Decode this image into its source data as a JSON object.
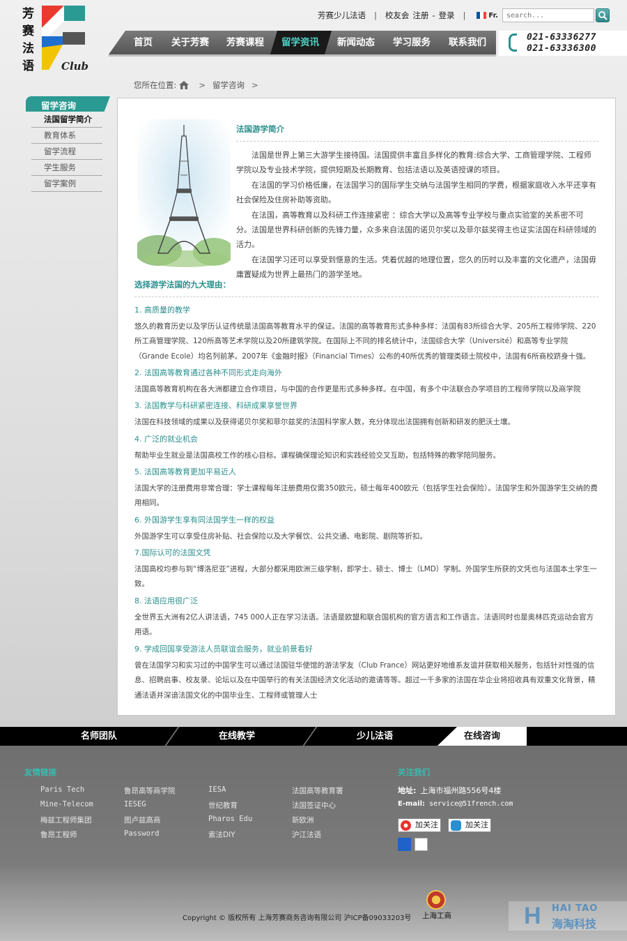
{
  "logo": {
    "chars": [
      "芳",
      "赛",
      "法",
      "语"
    ],
    "club": "Club"
  },
  "toplinks": {
    "kids": "芳赛少儿法语",
    "alumni": "校友会",
    "register": "注册",
    "dash": "-",
    "login": "登录",
    "lang": "Fr.",
    "sep": "|"
  },
  "search": {
    "placeholder": "search..."
  },
  "nav": {
    "items": [
      {
        "label": "首页"
      },
      {
        "label": "关于芳赛"
      },
      {
        "label": "芳赛课程"
      },
      {
        "label": "留学资讯"
      },
      {
        "label": "新闻动态"
      },
      {
        "label": "学习服务"
      },
      {
        "label": "联系我们"
      }
    ],
    "active_index": 3
  },
  "phone": {
    "line1": "021-63336277",
    "line2": "021-63336300"
  },
  "breadcrumb": {
    "prefix": "您所在位置:",
    "sep": ">",
    "current": "留学咨询"
  },
  "sidebar": {
    "title": "留学咨询",
    "items": [
      {
        "label": "法国留学简介"
      },
      {
        "label": "教育体系"
      },
      {
        "label": "留学流程"
      },
      {
        "label": "学生服务"
      },
      {
        "label": "留学案例"
      }
    ]
  },
  "intro": {
    "title": "法国游学简介",
    "paragraphs": [
      "法国是世界上第三大游学生接待国。法国提供丰富且多样化的教育:综合大学、工商管理学院、工程师学院以及专业技术学院，提供短期及长期教育、包括法语以及英语授课的项目。",
      "在法国的学习价格低廉，在法国学习的国际学生交纳与法国学生相同的学费，根据家庭收入水平还享有社会保险及住房补助等资助。",
      "在法国，高等教育以及科研工作连接紧密 ：综合大学以及高等专业学校与重点实验室的关系密不可分。法国是世界科研创新的先锋力量，众多来自法国的诺贝尔奖以及菲尔兹奖得主也证实法国在科研领域的活力。",
      "在法国学习还可以享受到惬意的生活。凭着优越的地理位置，您久的历时以及丰富的文化遗产，法国毋庸置疑成为世界上最热门的游学圣地。"
    ]
  },
  "reasons": {
    "title": "选择游学法国的九大理由：",
    "items": [
      {
        "title": "1. 高质量的教学",
        "text": "悠久的教育历史以及学历认证传统是法国高等教育水平的保证。法国的高等教育形式多种多样：法国有83所综合大学、205所工程师学院、220所工商管理学院、120所高等艺术学院以及20所建筑学院。在国际上不同的排名统计中，法国综合大学（Université）和高等专业学院（Grande Ecole）均名列前茅。2007年《金融时报》（Financial Times）公布的40所优秀的管理类硕士院校中，法国有6所商校跻身十强。"
      },
      {
        "title": "2. 法国高等教育通过各种不同形式走向海外",
        "text": "法国高等教育机构在各大洲都建立合作项目，与中国的合作更是形式多种多样。在中国，有多个中法联合办学项目的工程师学院以及商学院"
      },
      {
        "title": "3. 法国教学与科研紧密连接、科研成果享誉世界",
        "text": "法国在科技领域的成果以及获得诺贝尔奖和菲尔兹奖的法国科学家人数，充分体现出法国拥有创新和研发的肥沃土壤。"
      },
      {
        "title": "4. 广泛的就业机会",
        "text": "帮助毕业生就业是法国高校工作的核心目标。课程确保理论知识和实践经验交叉互助，包括特殊的教学陪同服务。"
      },
      {
        "title": "5. 法国高等教育更加平易近人",
        "text": "法国大学的注册费用非常合理：学士课程每年注册费用仅需350欧元，硕士每年400欧元（包括学生社会保险）。法国学生和外国游学生交纳的费用相同。"
      },
      {
        "title": "6. 外国游学生享有同法国学生一样的权益",
        "text": "外国游学生可以享受住房补贴、社会保险以及大学餐饮、公共交通、电影院、剧院等折扣。"
      },
      {
        "title": "7.国际认可的法国文凭",
        "text": "法国高校均参与到“博洛尼亚”进程，大部分都采用欧洲三级学制，即学士、硕士、博士（LMD）学制。外国学生所获的文凭也与法国本土学生一致。"
      },
      {
        "title": "8. 法语应用很广泛",
        "text": "全世界五大洲有2亿人讲法语，745 000人正在学习法语。法语是欧盟和联合国机构的官方语言和工作语言。法语同时也是奥林匹克运动会官方用语。"
      },
      {
        "title": "9. 学成回国享受游法人员联谊会服务，就业前景看好",
        "text": "曾在法国学习和实习过的中国学生可以通过法国驻华使馆的游法学友（Club France）网站更好地维系友谊并获取相关服务，包括针对性强的信息、招聘启事、校友录、论坛以及在中国举行的有关法国经济文化活动的邀请等等。超过一千多家的法国在华企业将招收具有双重文化背景，精通法语并深谙法国文化的中国毕业生、工程师或管理人士"
      }
    ]
  },
  "bottom_tabs": [
    {
      "label": "名师团队"
    },
    {
      "label": "在线教学"
    },
    {
      "label": "少儿法语"
    },
    {
      "label": "在线咨询"
    }
  ],
  "footer": {
    "links_title": "友情链接",
    "links": [
      [
        "Paris Tech",
        "鲁昂高等商学院",
        "IESA",
        "法国高等教育署"
      ],
      [
        "Mine-Telecom",
        "IESEG",
        "世纪教育",
        "法国签证中心"
      ],
      [
        "梅兹工程师集团",
        "图卢兹高商",
        "Pharos Edu",
        "新欧洲"
      ],
      [
        "鲁昂工程师",
        "Password",
        "索法DIY",
        "沪江法语"
      ]
    ],
    "follow_title": "关注我们",
    "address_label": "地址:",
    "address": "上海市福州路556号4楼",
    "email_label": "E-mail:",
    "email": "service@51french.com",
    "follow_weibo": "加关注",
    "follow_qq": "加关注",
    "copyright": "Copyright © 版权所有 上海芳赛商务咨询有限公司 沪ICP备09033203号",
    "gongshang": "上海工商",
    "watermark_top": "HAI TAO",
    "watermark_bottom": "海淘科技"
  },
  "colors": {
    "accent": "#2b8f8c",
    "nav_active": "#4fd1c6",
    "footer_head": "#38bdb0"
  }
}
